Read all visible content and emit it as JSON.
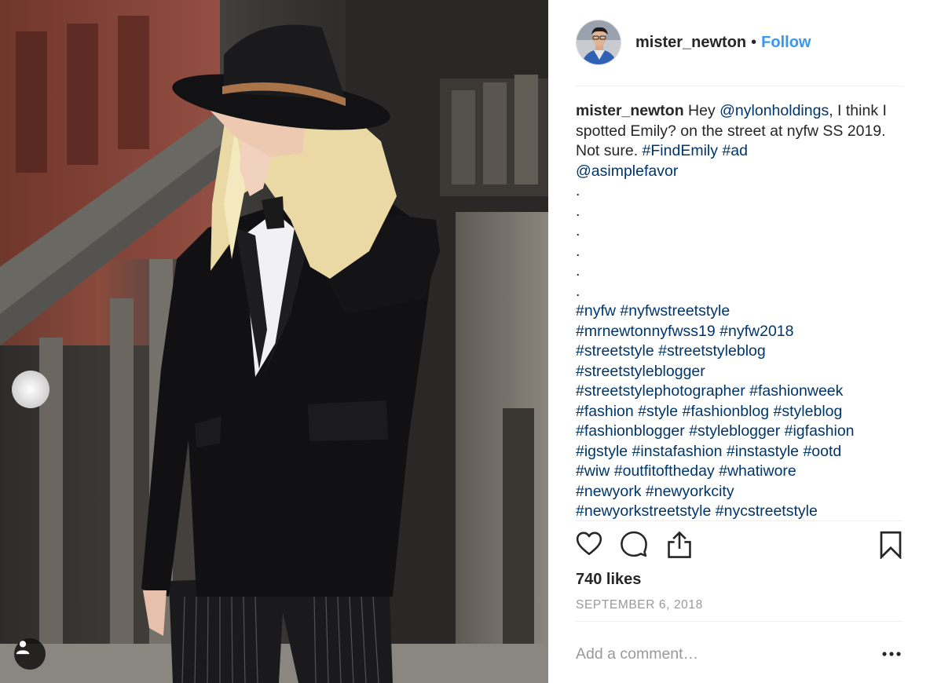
{
  "post": {
    "photo_description_icon": "user-tag-icon"
  },
  "header": {
    "username": "mister_newton",
    "separator": "•",
    "follow_label": "Follow"
  },
  "caption": {
    "username": "mister_newton",
    "text_1": " Hey ",
    "mention_1": "@nylonholdings",
    "text_2": ", I think I spotted Emily? on the street at nyfw SS 2019. Not sure. ",
    "tag_findemily": "#FindEmily",
    "text_3": " ",
    "tag_ad": "#ad",
    "mention_2": "@asimplefavor",
    "dots": [
      ".",
      ".",
      ".",
      ".",
      ".",
      "."
    ],
    "hashtags": [
      "#nyfw",
      "#nyfwstreetstyle",
      "#mrnewtonnyfwss19",
      "#nyfw2018",
      "#streetstyle",
      "#streetstyleblog",
      "#streetstyleblogger",
      "#streetstylephotographer",
      "#fashionweek",
      "#fashion",
      "#style",
      "#fashionblog",
      "#styleblog",
      "#fashionblogger",
      "#styleblogger",
      "#igfashion",
      "#igstyle",
      "#instafashion",
      "#instastyle",
      "#ootd",
      "#wiw",
      "#outfitoftheday",
      "#whatiwore",
      "#newyork",
      "#newyorkcity",
      "#newyorkstreetstyle",
      "#nycstreetstyle"
    ]
  },
  "actions": {
    "like_icon": "heart-icon",
    "comment_icon": "comment-icon",
    "share_icon": "share-icon",
    "save_icon": "bookmark-icon"
  },
  "likes": "740 likes",
  "date": "SEPTEMBER 6, 2018",
  "comment": {
    "placeholder": "Add a comment…",
    "more_label": "•••"
  },
  "colors": {
    "link": "#3897f0",
    "hashtag": "#003569",
    "muted": "#999999",
    "text": "#262626"
  }
}
